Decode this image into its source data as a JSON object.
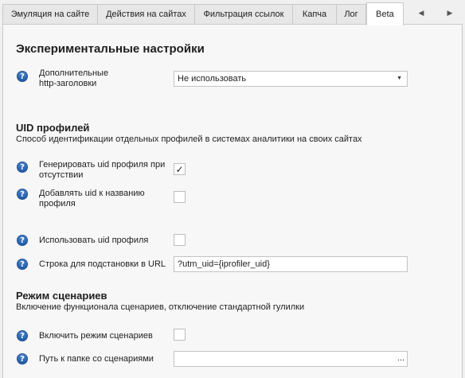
{
  "tabs": [
    {
      "label": "Эмуляция на сайте"
    },
    {
      "label": "Действия на сайтах"
    },
    {
      "label": "Фильтрация ссылок"
    },
    {
      "label": "Капча"
    },
    {
      "label": "Лог"
    },
    {
      "label": "Beta",
      "active": true
    }
  ],
  "tab_scroll": {
    "left": "◀",
    "right": "▶"
  },
  "experimental": {
    "title": "Экспериментальные настройки",
    "http_headers": {
      "label": "Дополнительные http-заголовки",
      "value": "Не использовать",
      "arrow": "▼"
    }
  },
  "uid": {
    "title": "UID профилей",
    "description": "Способ идентификации отдельных профилей в системах аналитики на своих сайтах",
    "generate": {
      "label": "Генерировать uid профиля при отсутствии",
      "checked": true,
      "mark": "✓"
    },
    "append_to_name": {
      "label": "Добавлять uid к названию профиля",
      "checked": false
    },
    "use_uid": {
      "label": "Использовать uid профиля",
      "checked": false
    },
    "url_string": {
      "label": "Строка для подстановки в URL",
      "value": "?utm_uid={iprofiler_uid}"
    }
  },
  "scenarios": {
    "title": "Режим сценариев",
    "description": "Включение функционала сценариев, отключение стандартной гулилки",
    "enable": {
      "label": "Включить режим сценариев",
      "checked": false
    },
    "folder": {
      "label": "Путь к папке со сценариями",
      "value": "",
      "browse": "..."
    }
  },
  "help_glyph": "?"
}
